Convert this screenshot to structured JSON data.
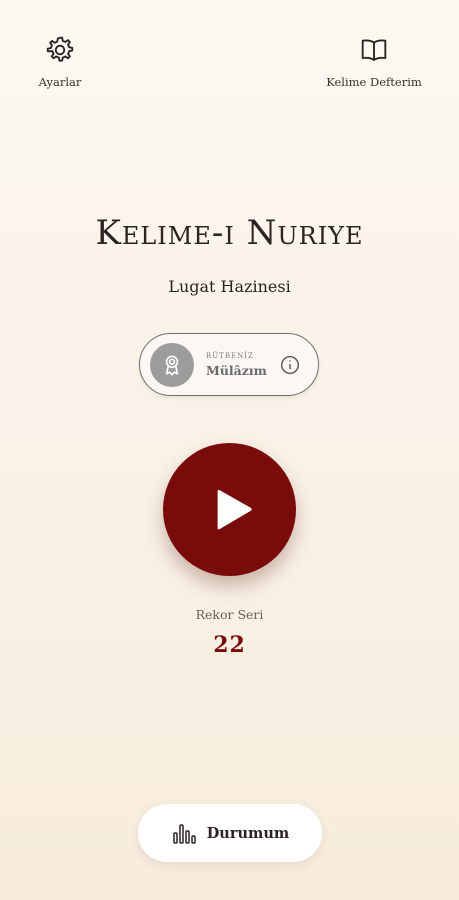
{
  "header": {
    "settings_label": "Ayarlar",
    "notebook_label": "Kelime Defterim"
  },
  "title": "Kelime-i Nuriye",
  "subtitle": "Lugat Hazinesi",
  "rank": {
    "caption": "RÜTBENİZ",
    "value": "Mülâzım"
  },
  "record": {
    "label": "Rekor Seri",
    "value": "22"
  },
  "status_button": {
    "label": "Durumum"
  },
  "colors": {
    "accent": "#7a0b0b",
    "background": "#fbf6ee"
  }
}
